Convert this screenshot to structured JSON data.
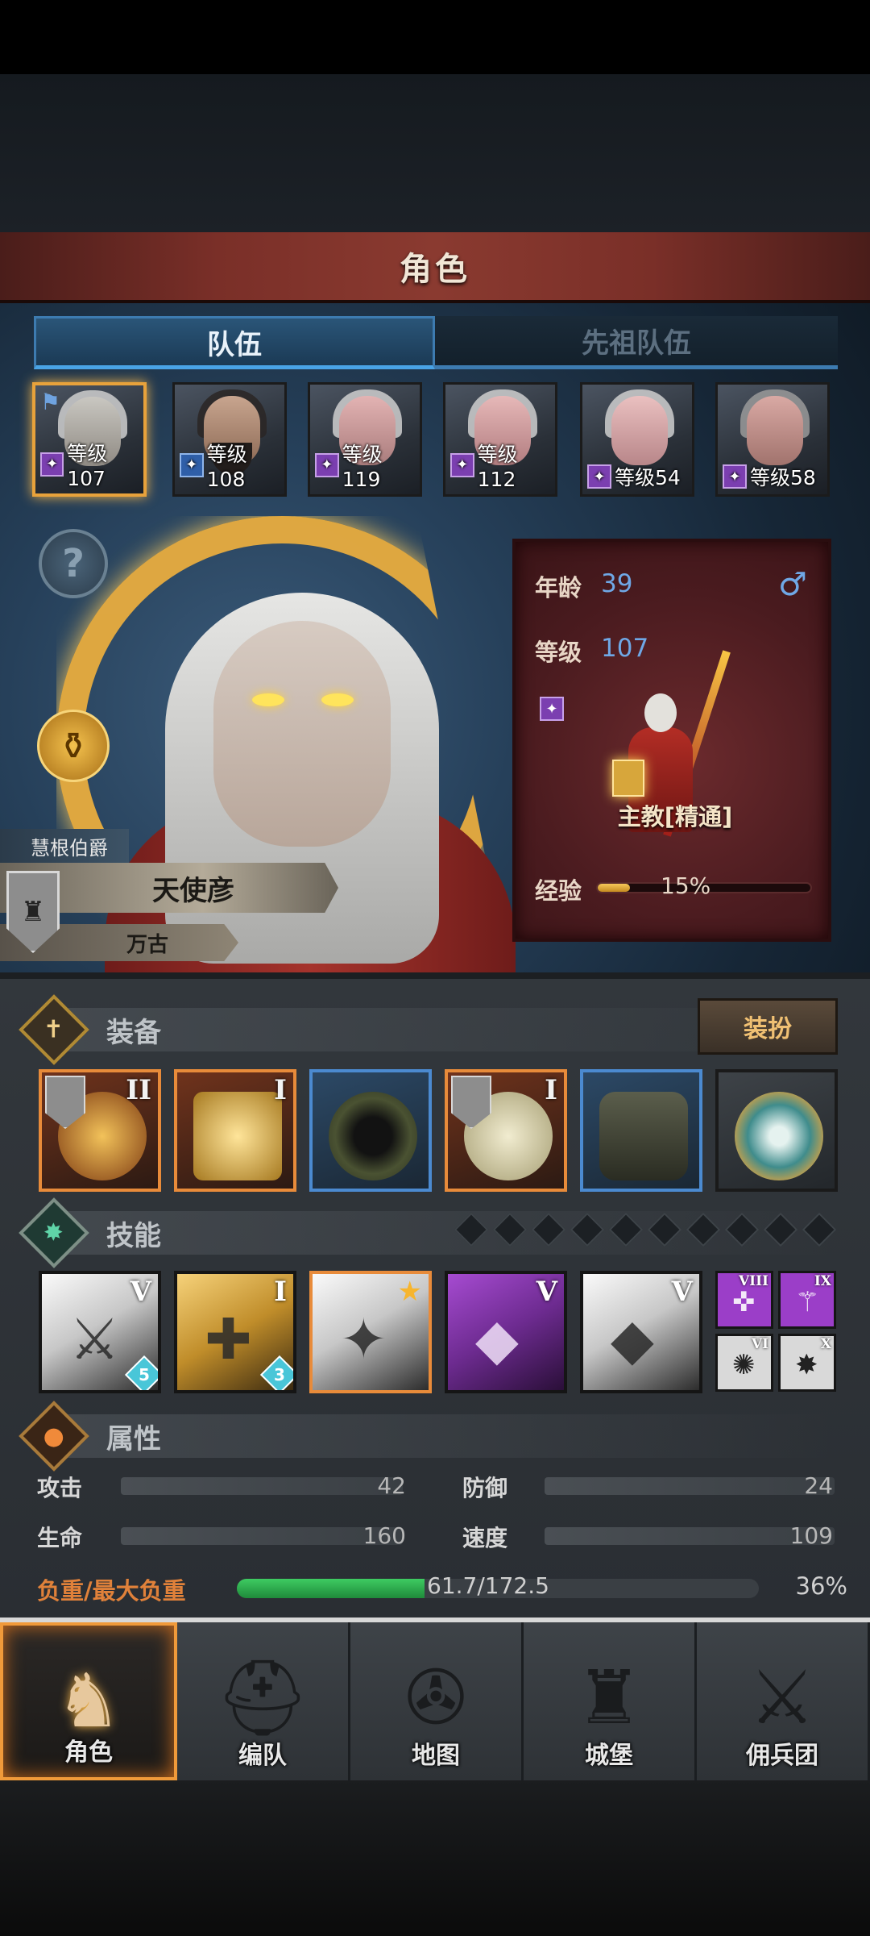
{
  "header": {
    "title": "角色"
  },
  "tabs": [
    {
      "label": "队伍",
      "active": true
    },
    {
      "label": "先祖队伍",
      "active": false
    }
  ],
  "roster": [
    {
      "level_text": "等级107",
      "selected": true,
      "badge": "purple"
    },
    {
      "level_text": "等级108",
      "selected": false,
      "badge": "blue"
    },
    {
      "level_text": "等级119",
      "selected": false,
      "badge": "purple"
    },
    {
      "level_text": "等级112",
      "selected": false,
      "badge": "purple"
    },
    {
      "level_text": "等级54",
      "selected": false,
      "badge": "purple"
    },
    {
      "level_text": "等级58",
      "selected": false,
      "badge": "purple"
    }
  ],
  "hero": {
    "title": "慧根伯爵",
    "name": "天使彦",
    "subtitle": "万古"
  },
  "info": {
    "age_label": "年龄",
    "age_value": "39",
    "gender_icon": "♂",
    "level_label": "等级",
    "level_value": "107",
    "class_name": "主教[精通]",
    "exp_label": "经验",
    "exp_percent_text": "15%",
    "exp_fraction": 0.15
  },
  "equipment": {
    "section_label": "装备",
    "dress_button": "装扮",
    "slots": [
      {
        "tier": "II",
        "rarity": "orange",
        "icon": "staff-icon"
      },
      {
        "tier": "I",
        "rarity": "orange",
        "icon": "holy-book-icon"
      },
      {
        "tier": "",
        "rarity": "blue",
        "icon": "hood-icon"
      },
      {
        "tier": "I",
        "rarity": "orange",
        "icon": "armor-icon"
      },
      {
        "tier": "",
        "rarity": "blue",
        "icon": "boots-icon"
      },
      {
        "tier": "",
        "rarity": "dark",
        "icon": "amulet-icon"
      }
    ]
  },
  "skills": {
    "section_label": "技能",
    "gem_slots": 10,
    "main": [
      {
        "tier": "V",
        "style": "plain",
        "badge": "5",
        "glyph": "⚔"
      },
      {
        "tier": "I",
        "style": "gold",
        "badge": "3",
        "glyph": "✚"
      },
      {
        "tier": "★",
        "style": "orange",
        "badge": "",
        "glyph": "✦"
      },
      {
        "tier": "V",
        "style": "purple",
        "badge": "",
        "glyph": "◆"
      },
      {
        "tier": "V",
        "style": "plain",
        "badge": "",
        "glyph": "◆"
      }
    ],
    "mini": [
      {
        "tier": "VIII",
        "color": "#9b3ec8",
        "glyph": "✜"
      },
      {
        "tier": "IX",
        "color": "#9b3ec8",
        "glyph": "⚚"
      },
      {
        "tier": "VI",
        "color": "#d9d9d9",
        "glyph": "✺"
      },
      {
        "tier": "X",
        "color": "#d9d9d9",
        "glyph": "✸"
      }
    ]
  },
  "attributes": {
    "section_label": "属性",
    "rows": [
      {
        "label": "攻击",
        "value": "42"
      },
      {
        "label": "防御",
        "value": "24"
      },
      {
        "label": "生命",
        "value": "160"
      },
      {
        "label": "速度",
        "value": "109"
      }
    ],
    "weight_label": "负重/最大负重",
    "weight_text": "61.7/172.5",
    "weight_percent_text": "36%",
    "weight_fraction": 0.36
  },
  "nav": [
    {
      "label": "角色",
      "active": true,
      "icon": "knight-icon"
    },
    {
      "label": "编队",
      "active": false,
      "icon": "helmet-icon"
    },
    {
      "label": "地图",
      "active": false,
      "icon": "compass-icon"
    },
    {
      "label": "城堡",
      "active": false,
      "icon": "castle-icon"
    },
    {
      "label": "佣兵团",
      "active": false,
      "icon": "mercenary-icon"
    }
  ],
  "colors": {
    "accent_orange": "#f09a3a",
    "tab_blue": "#49a3e6",
    "level_blue": "#6fa8e6",
    "weight_orange": "#e0813a",
    "weight_green": "#3ecb62"
  }
}
